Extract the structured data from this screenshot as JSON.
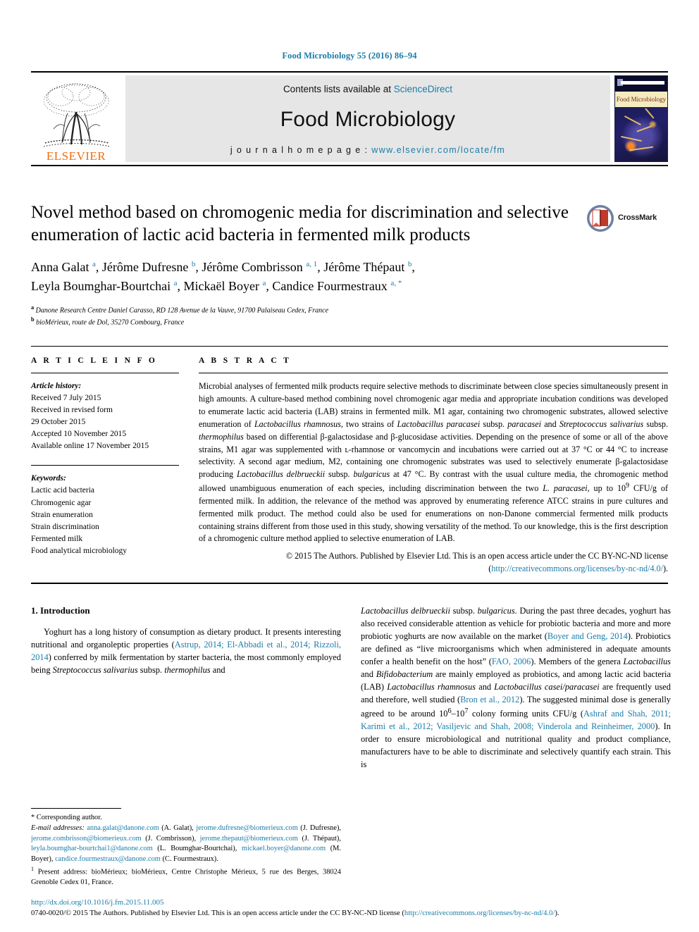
{
  "running_head": "Food Microbiology 55 (2016) 86–94",
  "masthead": {
    "publisher": "ELSEVIER",
    "contents_prefix": "Contents lists available at ",
    "contents_link": "ScienceDirect",
    "journal_name": "Food Microbiology",
    "homepage_prefix": "j o u r n a l   h o m e p a g e :  ",
    "homepage_url": "www.elsevier.com/locate/fm",
    "cover_title": "Food Microbiology"
  },
  "article": {
    "title": "Novel method based on chromogenic media for discrimination and selective enumeration of lactic acid bacteria in fermented milk products",
    "crossmark_label": "CrossMark",
    "authors_line1": "Anna Galat <sup>a</sup>, Jérôme Dufresne <sup>b</sup>, Jérôme Combrisson <sup>a, 1</sup>, Jérôme Thépaut <sup>b</sup>,",
    "authors_line2": "Leyla Boumghar-Bourtchai <sup>a</sup>, Mickaël Boyer <sup>a</sup>, Candice Fourmestraux <sup>a, *</sup>",
    "affiliation_a": "Danone Research Centre Daniel Carasso, RD 128 Avenue de la Vauve, 91700 Palaiseau Cedex, France",
    "affiliation_b": "bioMérieux, route de Dol, 35270 Combourg, France"
  },
  "article_info": {
    "heading": "A R T I C L E  I N F O",
    "history_label": "Article history:",
    "history": [
      "Received 7 July 2015",
      "Received in revised form",
      "29 October 2015",
      "Accepted 10 November 2015",
      "Available online 17 November 2015"
    ],
    "keywords_label": "Keywords:",
    "keywords": [
      "Lactic acid bacteria",
      "Chromogenic agar",
      "Strain enumeration",
      "Strain discrimination",
      "Fermented milk",
      "Food analytical microbiology"
    ]
  },
  "abstract": {
    "heading": "A B S T R A C T",
    "body": "Microbial analyses of fermented milk products require selective methods to discriminate between close species simultaneously present in high amounts. A culture-based method combining novel chromogenic agar media and appropriate incubation conditions was developed to enumerate lactic acid bacteria (LAB) strains in fermented milk. M1 agar, containing two chromogenic substrates, allowed selective enumeration of <i>Lactobacillus rhamnosus</i>, two strains of <i>Lactobacillus paracasei</i> subsp. <i>paracasei</i> and <i>Streptococcus salivarius</i> subsp. <i>thermophilus</i> based on differential β-galactosidase and β-glucosidase activities. Depending on the presence of some or all of the above strains, M1 agar was supplemented with ʟ-rhamnose or vancomycin and incubations were carried out at 37 °C or 44 °C to increase selectivity. A second agar medium, M2, containing one chromogenic substrates was used to selectively enumerate β-galactosidase producing <i>Lactobacillus delbrueckii</i> subsp. <i>bulgaricus</i> at 47 °C. By contrast with the usual culture media, the chromogenic method allowed unambiguous enumeration of each species, including discrimination between the two <i>L. paracasei</i>, up to 10<sup>9</sup> CFU/g of fermented milk. In addition, the relevance of the method was approved by enumerating reference ATCC strains in pure cultures and fermented milk product. The method could also be used for enumerations on non-Danone commercial fermented milk products containing strains different from those used in this study, showing versatility of the method. To our knowledge, this is the first description of a chromogenic culture method applied to selective enumeration of LAB.",
    "copyright_text": "© 2015 The Authors. Published by Elsevier Ltd. This is an open access article under the CC BY-NC-ND license (",
    "copyright_link": "http://creativecommons.org/licenses/by-nc-nd/4.0/",
    "copyright_suffix": ")."
  },
  "introduction": {
    "heading": "1.  Introduction",
    "left_paragraph": "Yoghurt has a long history of consumption as dietary product. It presents interesting nutritional and organoleptic properties (<span class=\"lnk\">Astrup, 2014; El-Abbadi et al., 2014; Rizzoli, 2014</span>) conferred by milk fermentation by starter bacteria, the most commonly employed being <i>Streptococcus salivarius</i> subsp. <i>thermophilus</i> and",
    "right_paragraph": "<i>Lactobacillus delbrueckii</i> subsp. <i>bulgaricus</i>. During the past three decades, yoghurt has also received considerable attention as vehicle for probiotic bacteria and more and more probiotic yoghurts are now available on the market (<span class=\"lnk\">Boyer and Geng, 2014</span>). Probiotics are defined as “live microorganisms which when administered in adequate amounts confer a health benefit on the host” (<span class=\"lnk\">FAO, 2006</span>). Members of the genera <i>Lactobacillus</i> and <i>Bifidobacterium</i> are mainly employed as probiotics, and among lactic acid bacteria (LAB) <i>Lactobacillus rhamnosus</i> and <i>Lactobacillus casei/paracasei</i> are frequently used and therefore, well studied (<span class=\"lnk\">Bron et al., 2012</span>). The suggested minimal dose is generally agreed to be around 10<sup>6</sup>–10<sup>7</sup> colony forming units CFU/g (<span class=\"lnk\">Ashraf and Shah, 2011; Karimi et al., 2012; Vasiljevic and Shah, 2008; Vinderola and Reinheimer, 2000</span>). In order to ensure microbiological and nutritional quality and product compliance, manufacturers have to be able to discriminate and selectively quantify each strain. This is"
  },
  "footnotes": {
    "corresponding": "* Corresponding author.",
    "emails": "<span class=\"ital\">E-mail addresses:</span> <span class=\"lnk\">anna.galat@danone.com</span> (A. Galat), <span class=\"lnk\">jerome.dufresne@biomerieux.com</span> (J. Dufresne), <span class=\"lnk\">jerome.combrisson@biomerieux.com</span> (J. Combrisson), <span class=\"lnk\">jerome.thepaut@biomerieux.com</span> (J. Thépaut), <span class=\"lnk\">leyla.boumghar-bourtchai1@danone.com</span> (L. Boumghar-Bourtchai), <span class=\"lnk\">mickael.boyer@danone.com</span> (M. Boyer), <span class=\"lnk\">candice.fourmestraux@danone.com</span> (C. Fourmestraux).",
    "present_address": "<sup>1</sup>  Present address: bioMérieux; bioMérieux, Centre Christophe Mérieux, 5 rue des Berges, 38024 Grenoble Cedex 01, France."
  },
  "page_footer": {
    "doi": "http://dx.doi.org/10.1016/j.fm.2015.11.005",
    "license_prefix": "0740-0020/© 2015 The Authors. Published by Elsevier Ltd. This is an open access article under the CC BY-NC-ND license (",
    "license_link": "http://creativecommons.org/licenses/by-nc-nd/4.0/",
    "license_suffix": ")."
  },
  "colors": {
    "link": "#1a7ca8",
    "elsevier_orange": "#f06f10",
    "band_gray": "#e6e6e6"
  }
}
